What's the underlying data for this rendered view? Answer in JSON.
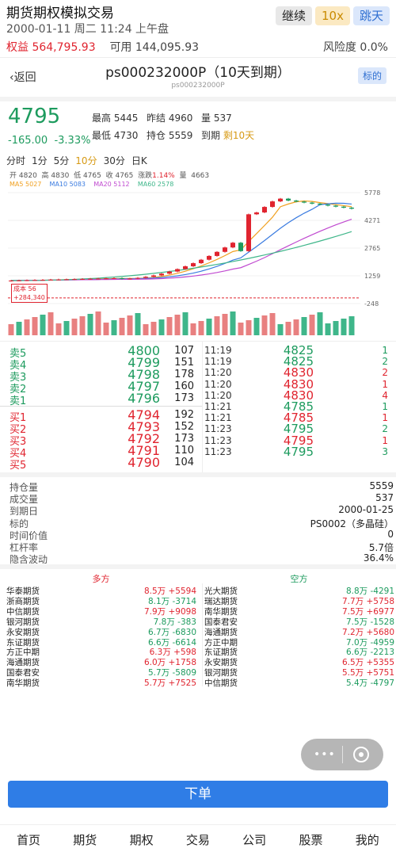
{
  "header": {
    "app_title": "期货期权模拟交易",
    "continue_label": "继续",
    "speed_label": "10x",
    "skip_label": "跳天",
    "datetime": "2000-01-11 周二 11:24 上午盘",
    "equity_label": "权益",
    "equity_value": "564,795.93",
    "available_label": "可用",
    "available_value": "144,095.93",
    "risk_label": "风险度",
    "risk_value": "0.0%"
  },
  "contract": {
    "back_label": "返回",
    "title": "ps000232000P（10天到期）",
    "subtitle": "ps000232000P",
    "tag_label": "标的"
  },
  "quote": {
    "last": "4795",
    "change": "-165.00",
    "change_pct": "-3.33%",
    "high_label": "最高",
    "high": "5445",
    "prev_settle_label": "昨结",
    "prev_settle": "4960",
    "vol_label": "量",
    "vol": "537",
    "low_label": "最低",
    "low": "4730",
    "oi_label": "持仓",
    "oi": "5559",
    "expire_label": "到期",
    "expire": "剩10天"
  },
  "periods": [
    "分时",
    "1分",
    "5分",
    "10分",
    "30分",
    "日K"
  ],
  "ohlc": {
    "open_label": "开",
    "open": "4820",
    "high_label": "高",
    "high": "4830",
    "low_label": "低",
    "low": "4765",
    "close_label": "收",
    "close": "4765",
    "chg_label": "涨跌",
    "chg": "1.14%",
    "vol_label": "量",
    "vol": "4663"
  },
  "ma": {
    "ma5": "MA5 5027",
    "ma10": "MA10 5083",
    "ma20": "MA20 5112",
    "ma60": "MA60 2578"
  },
  "chart_data": {
    "type": "candlestick",
    "y_ticks": [
      "5778",
      "4271",
      "2765",
      "1259",
      "-248"
    ],
    "cost_label": "成本 56",
    "cost_pnl": "+284,340",
    "ma_colors": {
      "ma5": "#f0a020",
      "ma10": "#3a7be0",
      "ma20": "#c04ad0",
      "ma60": "#3fb68a"
    }
  },
  "orderbook": {
    "asks": [
      {
        "label": "卖5",
        "price": "4800",
        "vol": "107"
      },
      {
        "label": "卖4",
        "price": "4799",
        "vol": "151"
      },
      {
        "label": "卖3",
        "price": "4798",
        "vol": "178"
      },
      {
        "label": "卖2",
        "price": "4797",
        "vol": "160"
      },
      {
        "label": "卖1",
        "price": "4796",
        "vol": "173"
      }
    ],
    "bids": [
      {
        "label": "买1",
        "price": "4794",
        "vol": "192"
      },
      {
        "label": "买2",
        "price": "4793",
        "vol": "152"
      },
      {
        "label": "买3",
        "price": "4792",
        "vol": "173"
      },
      {
        "label": "买4",
        "price": "4791",
        "vol": "110"
      },
      {
        "label": "买5",
        "price": "4790",
        "vol": "104"
      }
    ]
  },
  "trades": [
    {
      "t": "11:19",
      "p": "4825",
      "v": "1",
      "c": "g"
    },
    {
      "t": "11:19",
      "p": "4825",
      "v": "2",
      "c": "g"
    },
    {
      "t": "11:20",
      "p": "4830",
      "v": "2",
      "c": "r"
    },
    {
      "t": "11:20",
      "p": "4830",
      "v": "1",
      "c": "r"
    },
    {
      "t": "11:20",
      "p": "4830",
      "v": "4",
      "c": "r"
    },
    {
      "t": "11:21",
      "p": "4785",
      "v": "1",
      "c": "g"
    },
    {
      "t": "11:21",
      "p": "4785",
      "v": "1",
      "c": "r"
    },
    {
      "t": "11:23",
      "p": "4795",
      "v": "2",
      "c": "g"
    },
    {
      "t": "11:23",
      "p": "4795",
      "v": "1",
      "c": "r"
    },
    {
      "t": "11:23",
      "p": "4795",
      "v": "3",
      "c": "g"
    }
  ],
  "info": [
    {
      "k": "持仓量",
      "v": "5559"
    },
    {
      "k": "成交量",
      "v": "537"
    },
    {
      "k": "到期日",
      "v": "2000-01-25"
    },
    {
      "k": "标的",
      "v": "PS0002（多晶硅）"
    },
    {
      "k": "时间价值",
      "v": "0"
    },
    {
      "k": "杠杆率",
      "v": "5.7倍"
    },
    {
      "k": "隐含波动",
      "v": "36.4%"
    }
  ],
  "positions": {
    "long_title": "多方",
    "short_title": "空方",
    "long": [
      {
        "b": "华泰期货",
        "a": "8.5万 +5594"
      },
      {
        "b": "浙商期货",
        "a": "8.1万 -3714"
      },
      {
        "b": "中信期货",
        "a": "7.9万 +9098"
      },
      {
        "b": "银河期货",
        "a": "7.8万 -383"
      },
      {
        "b": "永安期货",
        "a": "6.7万 -6830"
      },
      {
        "b": "东证期货",
        "a": "6.6万 -6614"
      },
      {
        "b": "方正中期",
        "a": "6.3万 +598"
      },
      {
        "b": "海通期货",
        "a": "6.0万 +1758"
      },
      {
        "b": "国泰君安",
        "a": "5.7万 -5809"
      },
      {
        "b": "南华期货",
        "a": "5.7万 +7525"
      }
    ],
    "short": [
      {
        "b": "光大期货",
        "a": "8.8万 -4291"
      },
      {
        "b": "瑞达期货",
        "a": "7.7万 +5758"
      },
      {
        "b": "南华期货",
        "a": "7.5万 +6977"
      },
      {
        "b": "国泰君安",
        "a": "7.5万 -1528"
      },
      {
        "b": "海通期货",
        "a": "7.2万 +5680"
      },
      {
        "b": "方正中期",
        "a": "7.0万 -4959"
      },
      {
        "b": "东证期货",
        "a": "6.6万 -2213"
      },
      {
        "b": "永安期货",
        "a": "6.5万 +5355"
      },
      {
        "b": "银河期货",
        "a": "5.5万 +5751"
      },
      {
        "b": "中信期货",
        "a": "5.4万 -4797"
      }
    ]
  },
  "order_button": "下单",
  "nav": [
    "首页",
    "期货",
    "期权",
    "交易",
    "公司",
    "股票",
    "我的"
  ]
}
